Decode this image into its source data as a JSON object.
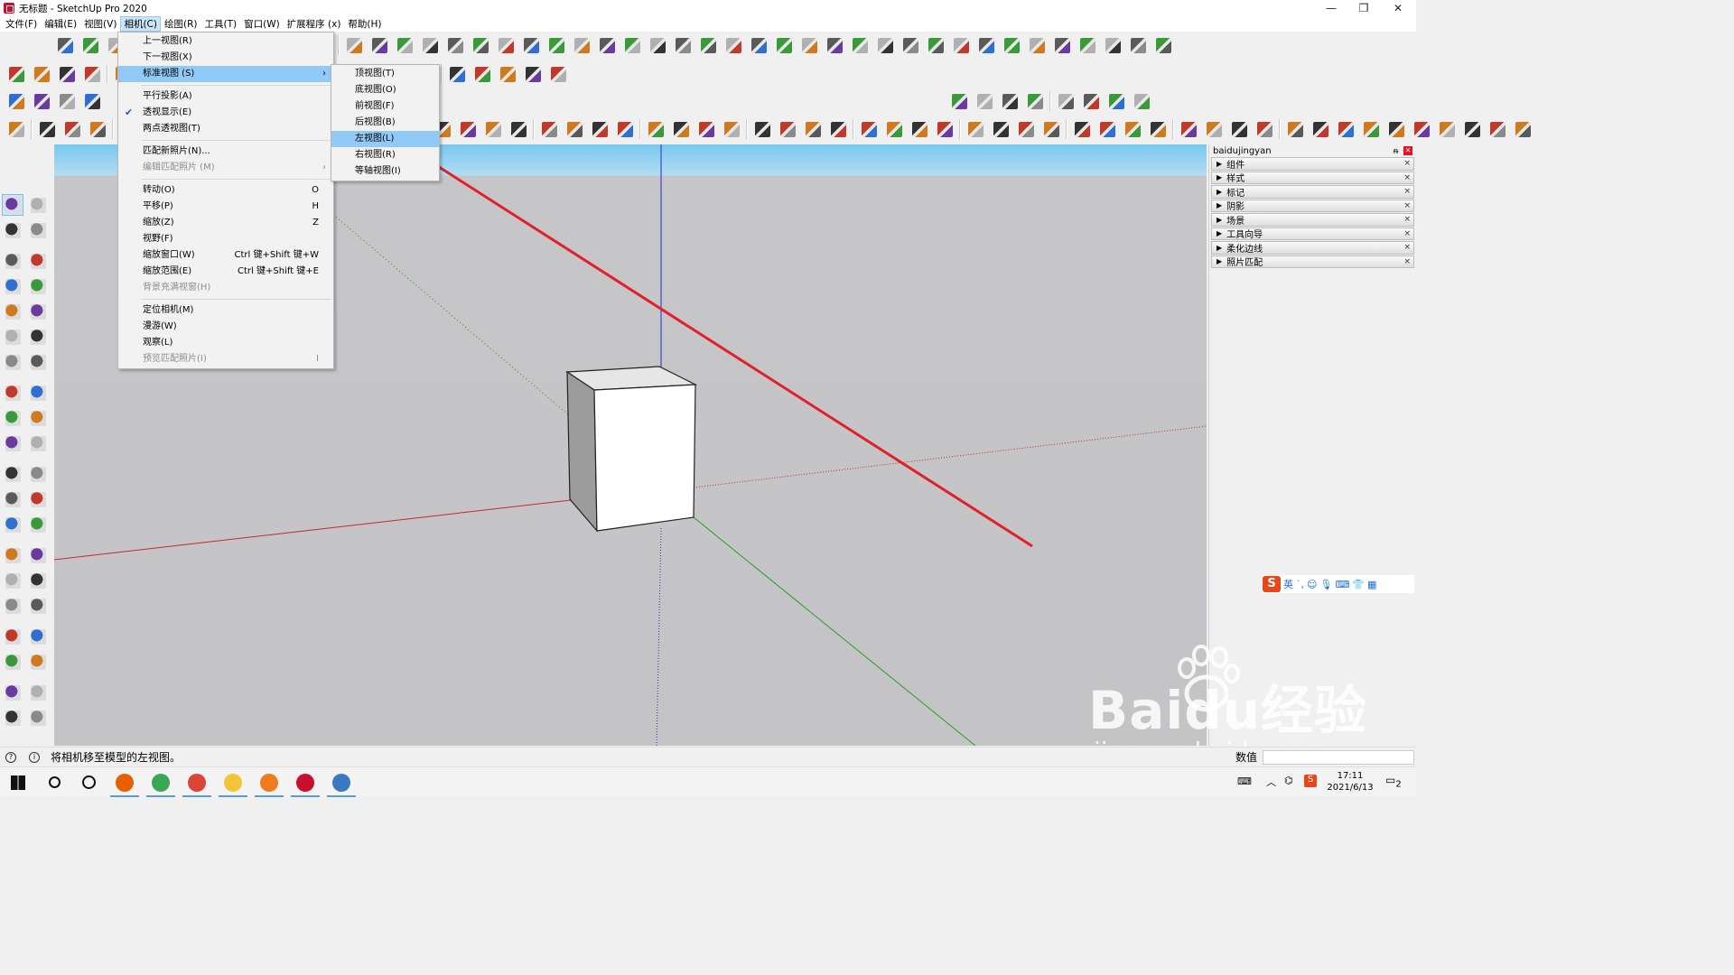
{
  "window": {
    "title": "无标题 - SketchUp Pro 2020",
    "controls": {
      "minimize": "—",
      "restore": "❐",
      "close": "✕"
    }
  },
  "menubar": [
    {
      "label": "文件(F)"
    },
    {
      "label": "编辑(E)"
    },
    {
      "label": "视图(V)"
    },
    {
      "label": "相机(C)",
      "active": true
    },
    {
      "label": "绘图(R)"
    },
    {
      "label": "工具(T)"
    },
    {
      "label": "窗口(W)"
    },
    {
      "label": "扩展程序 (x)"
    },
    {
      "label": "帮助(H)"
    }
  ],
  "camera_menu": {
    "items": [
      {
        "label": "上一视图(R)",
        "shortcut": "",
        "state": "normal"
      },
      {
        "label": "下一视图(X)",
        "shortcut": "",
        "state": "normal"
      },
      {
        "label": "标准视图 (S)",
        "shortcut": "",
        "state": "highlighted",
        "submenu": true
      },
      {
        "sep": true
      },
      {
        "label": "平行投影(A)",
        "shortcut": "",
        "state": "normal"
      },
      {
        "label": "透视显示(E)",
        "shortcut": "",
        "state": "normal",
        "checked": true
      },
      {
        "label": "两点透视图(T)",
        "shortcut": "",
        "state": "normal"
      },
      {
        "sep": true
      },
      {
        "label": "匹配新照片(N)...",
        "shortcut": "",
        "state": "normal"
      },
      {
        "label": "编辑匹配照片 (M)",
        "shortcut": "",
        "state": "disabled",
        "submenu": true
      },
      {
        "sep": true
      },
      {
        "label": "转动(O)",
        "shortcut": "O",
        "state": "normal"
      },
      {
        "label": "平移(P)",
        "shortcut": "H",
        "state": "normal"
      },
      {
        "label": "缩放(Z)",
        "shortcut": "Z",
        "state": "normal"
      },
      {
        "label": "视野(F)",
        "shortcut": "",
        "state": "normal"
      },
      {
        "label": "缩放窗口(W)",
        "shortcut": "Ctrl 键+Shift 键+W",
        "state": "normal"
      },
      {
        "label": "缩放范围(E)",
        "shortcut": "Ctrl 键+Shift 键+E",
        "state": "normal"
      },
      {
        "label": "背景充满视窗(H)",
        "shortcut": "",
        "state": "disabled"
      },
      {
        "sep": true
      },
      {
        "label": "定位相机(M)",
        "shortcut": "",
        "state": "normal"
      },
      {
        "label": "漫游(W)",
        "shortcut": "",
        "state": "normal"
      },
      {
        "label": "观察(L)",
        "shortcut": "",
        "state": "normal"
      },
      {
        "label": "预览匹配照片(I)",
        "shortcut": "I",
        "state": "disabled"
      }
    ]
  },
  "standard_views_submenu": {
    "items": [
      {
        "label": "顶视图(T)",
        "state": "normal"
      },
      {
        "label": "底视图(O)",
        "state": "normal"
      },
      {
        "label": "前视图(F)",
        "state": "normal"
      },
      {
        "label": "后视图(B)",
        "state": "normal"
      },
      {
        "label": "左视图(L)",
        "state": "highlighted"
      },
      {
        "label": "右视图(R)",
        "state": "normal"
      },
      {
        "label": "等轴视图(I)",
        "state": "normal"
      }
    ]
  },
  "default_tray": {
    "title": "baidujingyan",
    "trays": [
      "组件",
      "样式",
      "标记",
      "阴影",
      "场景",
      "工具向导",
      "柔化边线",
      "照片匹配"
    ]
  },
  "ime": {
    "logo": "S",
    "mode": "英"
  },
  "status": {
    "message": "将相机移至模型的左视图。",
    "measure_label": "数值",
    "measure_value": ""
  },
  "taskbar": {
    "time": "17:11",
    "date": "2021/6/13",
    "notifications": "2",
    "apps": [
      "windows-start-icon",
      "search-icon",
      "task-view-icon",
      "firefox-icon",
      "browser-green-icon",
      "chrome-icon",
      "star-folder-icon",
      "orange-browser-icon",
      "sketchup-icon",
      "winrar-icon"
    ]
  },
  "watermark": {
    "brand": "Baidu经验",
    "url": "jingyan.baidu.com"
  },
  "colors": {
    "menu_highlight": "#91c9f7",
    "sky": "#8fd0f0",
    "ground": "#c4c4c7",
    "annotation_arrow": "#e0212b",
    "axis_red": "#cc2222",
    "axis_green": "#22a022",
    "axis_blue": "#2222cc"
  }
}
